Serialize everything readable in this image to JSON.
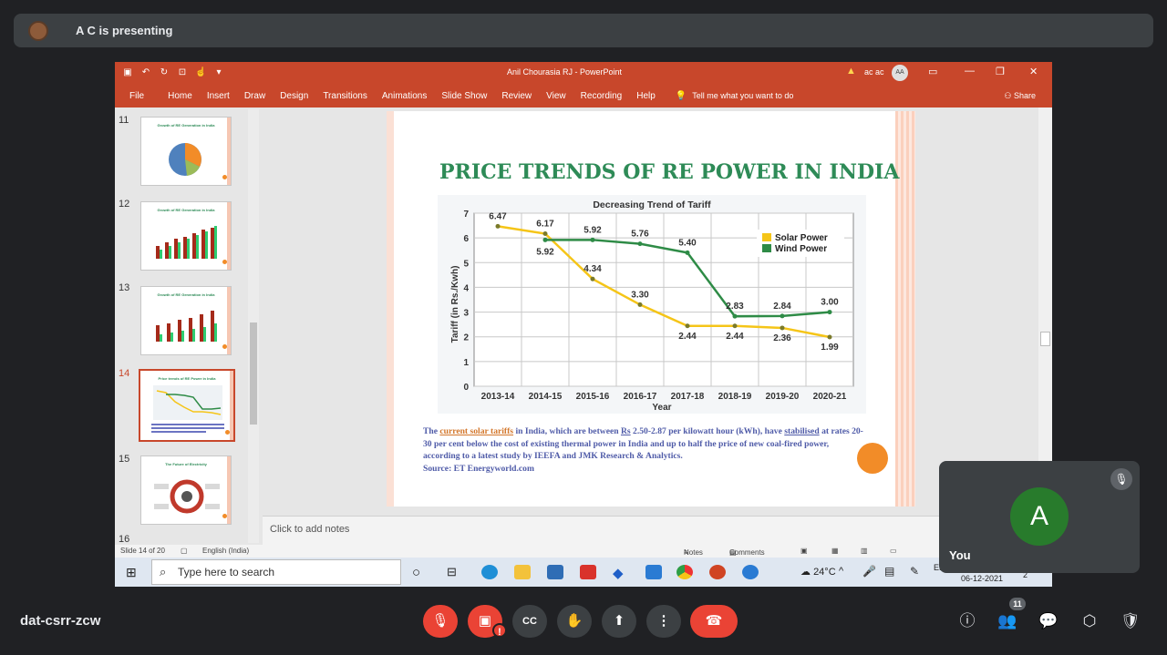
{
  "meet": {
    "presenter_text": "A C is presenting",
    "meeting_code": "dat-csrr-zcw",
    "self_name": "You",
    "self_initial": "A",
    "people_count": "11",
    "alert_mark": "!"
  },
  "ppt": {
    "window_title": "Anil Chourasia RJ  -  PowerPoint",
    "user_name": "ac ac",
    "user_initials": "AA",
    "tabs": [
      "File",
      "Home",
      "Insert",
      "Draw",
      "Design",
      "Transitions",
      "Animations",
      "Slide Show",
      "Review",
      "View",
      "Recording",
      "Help"
    ],
    "tell_me": "Tell me what you want to do",
    "share": "Share",
    "notes_placeholder": "Click to add notes",
    "status_slide": "Slide 14 of 20",
    "status_lang": "English (India)",
    "status_notes": "Notes",
    "status_comments": "Comments",
    "thumbnails": [
      {
        "num": "11",
        "title": "Growth of RE Generation in India",
        "kind": "pie"
      },
      {
        "num": "12",
        "title": "Growth of RE Generation in India",
        "kind": "bars"
      },
      {
        "num": "13",
        "title": "Growth of RE Generation in India",
        "kind": "bars"
      },
      {
        "num": "14",
        "title": "Price trends of RE Power in India",
        "kind": "line"
      },
      {
        "num": "15",
        "title": "The Future of Electricity",
        "kind": "diagram"
      },
      {
        "num": "16",
        "title": "",
        "kind": "partial"
      }
    ]
  },
  "slide": {
    "title": "PRICE TRENDS OF RE POWER IN INDIA",
    "body_the": "The",
    "body_link": "current solar tariffs",
    "body_1": "in India, which are between",
    "body_rs": "Rs",
    "body_2": "2.50-2.87 per kilowatt hour (kWh), have",
    "body_stab": "stabilised",
    "body_3": "at rates 20-30 per cent below the cost of existing thermal power in India and up to half the price of new coal-fired power, according to a latest study by IEEFA and JMK Research & Analytics.",
    "source": "Source: ET Energyworld.com"
  },
  "chart_data": {
    "type": "line",
    "title": "Decreasing Trend of Tariff",
    "xlabel": "Year",
    "ylabel": "Tariff (in Rs./Kwh)",
    "ylim": [
      0,
      7
    ],
    "yticks": [
      "0",
      "1",
      "2",
      "3",
      "4",
      "5",
      "6",
      "7"
    ],
    "grid": true,
    "legend_position": "top-right",
    "categories": [
      "2013-14",
      "2014-15",
      "2015-16",
      "2016-17",
      "2017-18",
      "2018-19",
      "2019-20",
      "2020-21"
    ],
    "series": [
      {
        "name": "Solar Power",
        "color": "#f5c518",
        "values": [
          6.47,
          6.17,
          4.34,
          3.3,
          2.44,
          2.44,
          2.36,
          1.99
        ],
        "labels": [
          "6.47",
          "6.17",
          "4.34",
          "3.30",
          "2.44",
          "2.44",
          "2.36",
          "1.99"
        ]
      },
      {
        "name": "Wind Power",
        "color": "#2e8b46",
        "values": [
          null,
          5.92,
          5.92,
          5.76,
          5.4,
          2.83,
          2.84,
          3.0
        ],
        "labels": [
          "",
          "5.92",
          "5.92",
          "5.76",
          "5.40",
          "2.83",
          "2.84",
          "3.00"
        ]
      }
    ]
  },
  "taskbar": {
    "search_placeholder": "Type here to search",
    "temperature": "24°C",
    "lang": "ENG",
    "date": "06-12-2021",
    "notif_count": "2"
  }
}
